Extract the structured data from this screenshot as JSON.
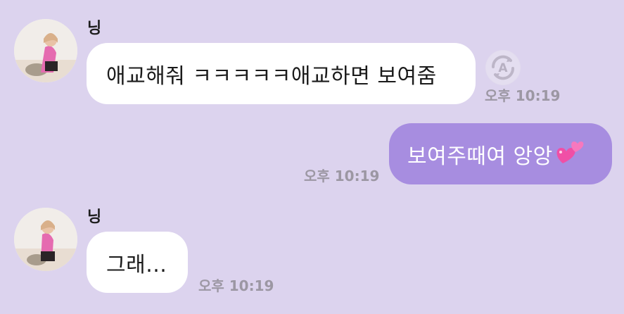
{
  "messages": [
    {
      "sender": "닝",
      "text": "애교해줘 ㅋㅋㅋㅋㅋ애교하면 보여줌",
      "time": "오후 10:19",
      "translate_icon": "translate-icon"
    },
    {
      "text": "보여주때여 앙앙",
      "emoji": "two-hearts-icon",
      "time": "오후 10:19"
    },
    {
      "sender": "닝",
      "text": "그래...",
      "time": "오후 10:19"
    }
  ],
  "colors": {
    "background": "#dcd3ee",
    "incoming_bubble": "#ffffff",
    "outgoing_bubble": "#a78de0",
    "timestamp": "#9c97a3"
  }
}
